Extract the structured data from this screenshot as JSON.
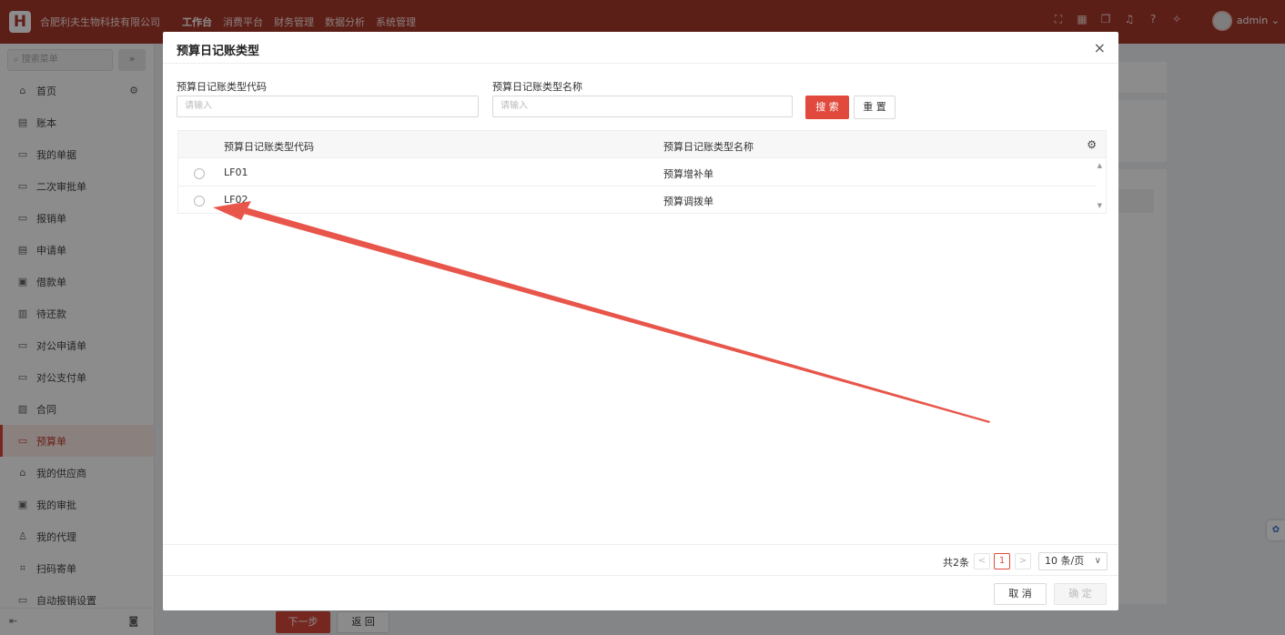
{
  "header": {
    "logo_text": "H",
    "company": "合肥利夫生物科技有限公司",
    "nav": [
      "工作台",
      "消费平台",
      "财务管理",
      "数据分析",
      "系统管理"
    ],
    "icons": [
      "fullscreen-icon",
      "apps-icon",
      "layers-icon",
      "bell-icon",
      "help-icon",
      "theme-icon"
    ],
    "username": "admin"
  },
  "sidebar": {
    "search_placeholder": "搜索菜单",
    "collapse_label": "»",
    "items": [
      "首页",
      "账本",
      "我的单据",
      "二次审批单",
      "报销单",
      "申请单",
      "借款单",
      "待还款",
      "对公申请单",
      "对公支付单",
      "合同",
      "预算单",
      "我的供应商",
      "我的审批",
      "我的代理",
      "扫码寄单",
      "自动报销设置"
    ],
    "active_item": "预算单"
  },
  "background": {
    "next_label": "下一步",
    "back_label": "返 回"
  },
  "modal": {
    "title": "预算日记账类型",
    "close_label": "×",
    "filters": {
      "code_label": "预算日记账类型代码",
      "code_placeholder": "请输入",
      "name_label": "预算日记账类型名称",
      "name_placeholder": "请输入"
    },
    "search_label": "搜 索",
    "reset_label": "重 置",
    "table": {
      "columns": [
        "预算日记账类型代码",
        "预算日记账类型名称"
      ],
      "rows": [
        {
          "code": "LF01",
          "name": "预算增补单"
        },
        {
          "code": "LF02",
          "name": "预算调拨单"
        }
      ]
    },
    "pager": {
      "total": "共2条",
      "prev": "<",
      "page": "1",
      "next": ">",
      "page_size": "10 条/页"
    },
    "cancel_label": "取 消",
    "ok_label": "确 定"
  },
  "colors": {
    "header_bg": "#a8392c",
    "accent": "#e0493b",
    "arrow": "#e8554a"
  }
}
